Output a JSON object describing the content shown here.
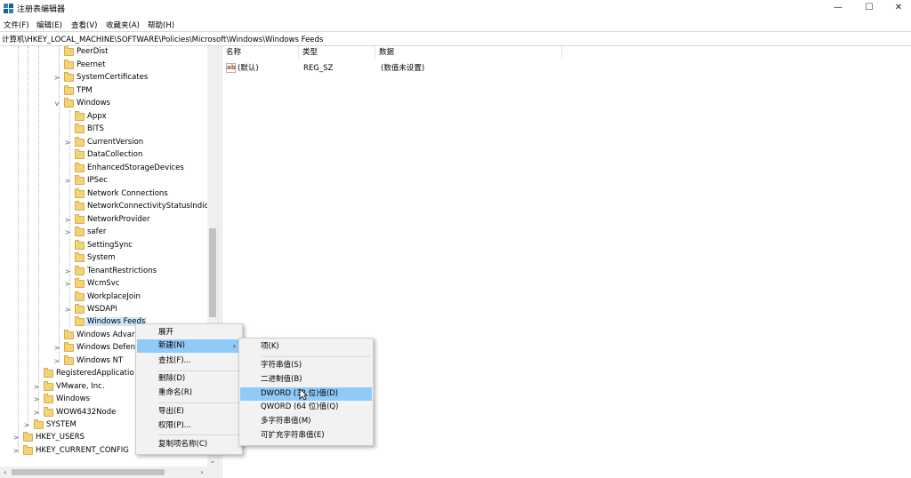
{
  "window": {
    "title": "注册表编辑器",
    "min_icon": "—",
    "max_icon": "☐",
    "close_icon": "✕"
  },
  "menu": [
    "文件(F)",
    "编辑(E)",
    "查看(V)",
    "收藏夹(A)",
    "帮助(H)"
  ],
  "address": "计算机\\HKEY_LOCAL_MACHINE\\SOFTWARE\\Policies\\Microsoft\\Windows\\Windows Feeds",
  "tree": [
    {
      "label": "PeerDist",
      "expander": ""
    },
    {
      "label": "Peernet",
      "expander": ""
    },
    {
      "label": "SystemCertificates",
      "expander": ">"
    },
    {
      "label": "TPM",
      "expander": ""
    },
    {
      "label": "Windows",
      "expander": "v"
    },
    {
      "label": "Appx",
      "expander": ""
    },
    {
      "label": "BITS",
      "expander": ""
    },
    {
      "label": "CurrentVersion",
      "expander": ">"
    },
    {
      "label": "DataCollection",
      "expander": ""
    },
    {
      "label": "EnhancedStorageDevices",
      "expander": ""
    },
    {
      "label": "IPSec",
      "expander": ">"
    },
    {
      "label": "Network Connections",
      "expander": ""
    },
    {
      "label": "NetworkConnectivityStatusIndica",
      "expander": ""
    },
    {
      "label": "NetworkProvider",
      "expander": ">"
    },
    {
      "label": "safer",
      "expander": ">"
    },
    {
      "label": "SettingSync",
      "expander": ""
    },
    {
      "label": "System",
      "expander": ""
    },
    {
      "label": "TenantRestrictions",
      "expander": ">"
    },
    {
      "label": "WcmSvc",
      "expander": ">"
    },
    {
      "label": "WorkplaceJoin",
      "expander": ""
    },
    {
      "label": "WSDAPI",
      "expander": ">"
    },
    {
      "label": "Windows Feeds",
      "expander": ""
    },
    {
      "label": "Windows Advar",
      "expander": ""
    },
    {
      "label": "Windows Defen",
      "expander": ">"
    },
    {
      "label": "Windows NT",
      "expander": ">"
    },
    {
      "label": "RegisteredApplicatio",
      "expander": ""
    },
    {
      "label": "VMware, Inc.",
      "expander": ">"
    },
    {
      "label": "Windows",
      "expander": ">"
    },
    {
      "label": "WOW6432Node",
      "expander": ">"
    },
    {
      "label": "SYSTEM",
      "expander": ">"
    },
    {
      "label": "HKEY_USERS",
      "expander": ">"
    },
    {
      "label": "HKEY_CURRENT_CONFIG",
      "expander": ">"
    }
  ],
  "columns": {
    "name": "名称",
    "type": "类型",
    "data": "数据"
  },
  "values": [
    {
      "icon": "ab",
      "name": "(默认)",
      "type": "REG_SZ",
      "data": "(数值未设置)"
    }
  ],
  "context_menu": {
    "expand": "展开",
    "new": "新建(N)",
    "find": "查找(F)...",
    "delete": "删除(D)",
    "rename": "重命名(R)",
    "export": "导出(E)",
    "permissions": "权限(P)...",
    "copy_key_name": "复制项名称(C)"
  },
  "submenu": {
    "key": "项(K)",
    "string": "字符串值(S)",
    "binary": "二进制值(B)",
    "dword": "DWORD (32 位)值(D)",
    "qword": "QWORD (64 位)值(Q)",
    "multi_string": "多字符串值(M)",
    "expandable_string": "可扩充字符串值(E)"
  }
}
